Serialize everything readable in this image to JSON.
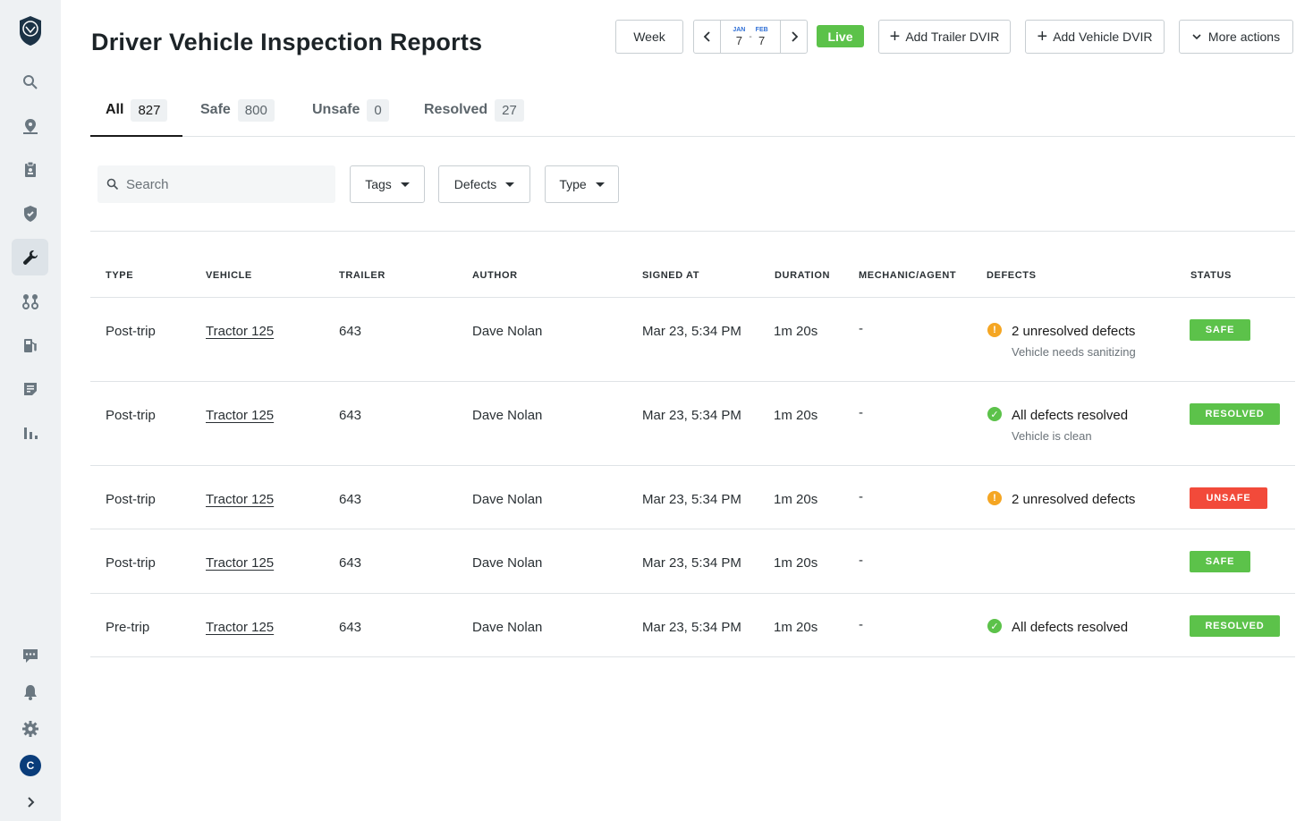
{
  "header": {
    "title": "Driver Vehicle Inspection Reports",
    "week_label": "Week",
    "date_from": {
      "month": "JAN",
      "day": "7"
    },
    "date_sep": "-",
    "date_to": {
      "month": "FEB",
      "day": "7"
    },
    "live_label": "Live",
    "add_trailer_label": "Add Trailer DVIR",
    "add_vehicle_label": "Add Vehicle DVIR",
    "more_actions_label": "More actions"
  },
  "tabs": [
    {
      "label": "All",
      "count": "827",
      "active": true
    },
    {
      "label": "Safe",
      "count": "800"
    },
    {
      "label": "Unsafe",
      "count": "0"
    },
    {
      "label": "Resolved",
      "count": "27"
    }
  ],
  "filters": {
    "search_placeholder": "Search",
    "tags_label": "Tags",
    "defects_label": "Defects",
    "type_label": "Type"
  },
  "table": {
    "headers": {
      "type": "TYPE",
      "vehicle": "VEHICLE",
      "trailer": "TRAILER",
      "author": "AUTHOR",
      "signed_at": "SIGNED AT",
      "duration": "DURATION",
      "mechanic": "MECHANIC/AGENT",
      "defects": "DEFECTS",
      "status": "STATUS"
    },
    "rows": [
      {
        "type": "Post-trip",
        "vehicle": "Tractor 125",
        "trailer": "643",
        "author": "Dave Nolan",
        "signed_at": "Mar 23, 5:34 PM",
        "duration": "1m 20s",
        "mechanic": "-",
        "defect_title": "2 unresolved defects",
        "defect_sub": "Vehicle needs sanitizing",
        "defect_icon": "warning-icon",
        "status": "SAFE"
      },
      {
        "type": "Post-trip",
        "vehicle": "Tractor 125",
        "trailer": "643",
        "author": "Dave Nolan",
        "signed_at": "Mar 23, 5:34 PM",
        "duration": "1m 20s",
        "mechanic": "-",
        "defect_title": "All defects resolved",
        "defect_sub": "Vehicle is clean",
        "defect_icon": "check-icon",
        "status": "RESOLVED"
      },
      {
        "type": "Post-trip",
        "vehicle": "Tractor 125",
        "trailer": "643",
        "author": "Dave Nolan",
        "signed_at": "Mar 23, 5:34 PM",
        "duration": "1m 20s",
        "mechanic": "-",
        "defect_title": "2 unresolved defects",
        "defect_sub": "",
        "defect_icon": "warning-icon",
        "status": "UNSAFE"
      },
      {
        "type": "Post-trip",
        "vehicle": "Tractor 125",
        "trailer": "643",
        "author": "Dave Nolan",
        "signed_at": "Mar 23, 5:34 PM",
        "duration": "1m 20s",
        "mechanic": "-",
        "defect_title": "",
        "defect_sub": "",
        "defect_icon": "",
        "status": "SAFE"
      },
      {
        "type": "Pre-trip",
        "vehicle": "Tractor 125",
        "trailer": "643",
        "author": "Dave Nolan",
        "signed_at": "Mar 23, 5:34 PM",
        "duration": "1m 20s",
        "mechanic": "-",
        "defect_title": "All defects resolved",
        "defect_sub": "",
        "defect_icon": "check-icon",
        "status": "RESOLVED"
      }
    ]
  },
  "sidebar": {
    "avatar_initial": "C",
    "icons": [
      "logo-icon",
      "search-icon",
      "map-pin-icon",
      "clipboard-icon",
      "shield-icon",
      "wrench-icon",
      "routes-icon",
      "fuel-icon",
      "document-icon",
      "bar-chart-icon",
      "chat-icon",
      "bell-icon",
      "gear-icon",
      "chevron-right-icon"
    ]
  },
  "colors": {
    "safe": "#5cc24a",
    "unsafe": "#f24a3a",
    "warning": "#f5a623",
    "accent_blue": "#2f6fd6",
    "sidebar_bg": "#eef1f3"
  }
}
